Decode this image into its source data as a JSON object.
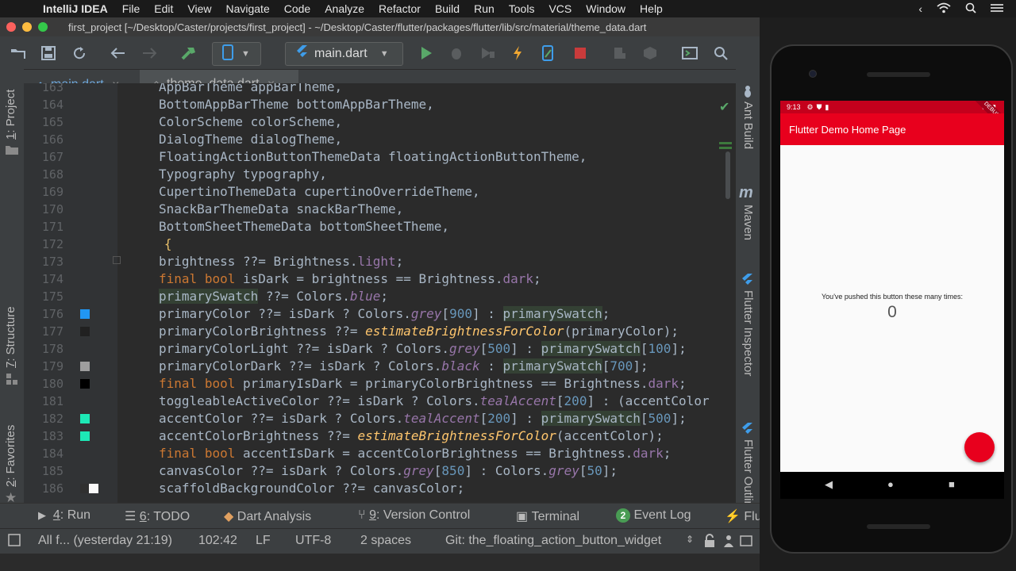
{
  "colors": {
    "accent_red": "#e8001d",
    "tab_underline": "#4a88c7",
    "run_green": "#59a869",
    "stop_red": "#c93b3b"
  },
  "mac_menu": {
    "app": "IntelliJ IDEA",
    "items": [
      "File",
      "Edit",
      "View",
      "Navigate",
      "Code",
      "Analyze",
      "Refactor",
      "Build",
      "Run",
      "Tools",
      "VCS",
      "Window",
      "Help"
    ]
  },
  "window": {
    "title": "first_project [~/Desktop/Caster/projects/first_project] - ~/Desktop/Caster/flutter/packages/flutter/lib/src/material/theme_data.dart"
  },
  "toolbar": {
    "run_config": "main.dart",
    "icons": [
      "folder-icon",
      "save-icon",
      "sync-icon",
      "back-icon",
      "forward-icon",
      "build-icon",
      "device-icon",
      "run-icon",
      "debug-icon",
      "coverage-icon",
      "hot-reload-icon",
      "flutter-attach-icon",
      "stop-icon",
      "search-icon"
    ]
  },
  "tabs": [
    {
      "label": "main.dart",
      "close": "✕"
    },
    {
      "label": "theme_data.dart",
      "close": "✕"
    }
  ],
  "left_tools": {
    "project": {
      "num": "1",
      "label": ": Project"
    },
    "structure": {
      "num": "7",
      "label": ": Structure"
    },
    "favorites": {
      "num": "2",
      "label": ": Favorites"
    }
  },
  "right_tools": [
    "Ant Build",
    "Maven",
    "Flutter Inspector",
    "Flutter Outline"
  ],
  "editor": {
    "line_numbers": [
      "163",
      "164",
      "165",
      "166",
      "167",
      "168",
      "169",
      "170",
      "171",
      "172",
      "173",
      "174",
      "175",
      "176",
      "177",
      "178",
      "179",
      "180",
      "181",
      "182",
      "183",
      "184",
      "185",
      "186"
    ]
  },
  "tool_tabs": {
    "run": {
      "num": "4",
      "label": ": Run"
    },
    "todo": {
      "num": "6",
      "label": ": TODO"
    },
    "dart": {
      "label": "Dart Analysis"
    },
    "vcs": {
      "num": "9",
      "label": ": Version Control"
    },
    "terminal": {
      "label": "Terminal"
    },
    "eventlog": {
      "badge": "2",
      "label": "Event Log"
    },
    "flutter": {
      "label": "Flu"
    }
  },
  "status": {
    "message": "All f... (yesterday 21:19)",
    "position": "102:42",
    "line_sep": "LF",
    "encoding": "UTF-8",
    "indent": "2 spaces",
    "git": "Git: the_floating_action_button_widget"
  },
  "phone": {
    "time": "9:13",
    "app_title": "Flutter Demo Home Page",
    "counter_label": "You've pushed this button these many times:",
    "counter_value": "0",
    "debug_banner": "DEBUG"
  }
}
